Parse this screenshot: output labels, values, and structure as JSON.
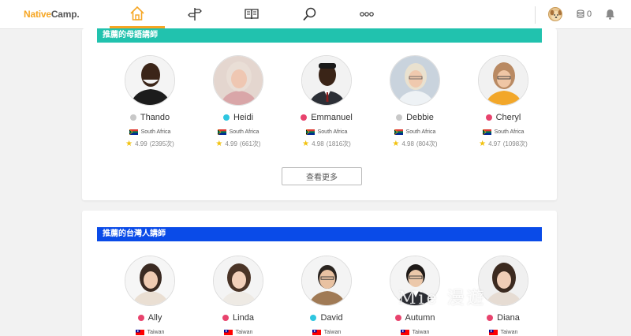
{
  "brand": {
    "part1": "Native",
    "part2": "Camp."
  },
  "nav": {
    "items": [
      {
        "icon": "home-icon",
        "active": true
      },
      {
        "icon": "signpost-icon",
        "active": false
      },
      {
        "icon": "book-icon",
        "active": false
      },
      {
        "icon": "search-icon",
        "active": false
      },
      {
        "icon": "more-icon",
        "active": false
      }
    ],
    "coins": "0"
  },
  "section1": {
    "title": "推薦的母語講師",
    "color": "#21c2ae",
    "more_label": "查看更多",
    "teachers": [
      {
        "name": "Thando",
        "status": "#c8c8c8",
        "country": "South Africa",
        "rating": "4.99",
        "reviews": "(2395次)"
      },
      {
        "name": "Heidi",
        "status": "#2ec6e0",
        "country": "South Africa",
        "rating": "4.99",
        "reviews": "(661次)"
      },
      {
        "name": "Emmanuel",
        "status": "#e8436d",
        "country": "South Africa",
        "rating": "4.98",
        "reviews": "(1816次)"
      },
      {
        "name": "Debbie",
        "status": "#c8c8c8",
        "country": "South Africa",
        "rating": "4.98",
        "reviews": "(804次)"
      },
      {
        "name": "Cheryl",
        "status": "#e8436d",
        "country": "South Africa",
        "rating": "4.97",
        "reviews": "(1098次)"
      }
    ]
  },
  "section2": {
    "title": "推薦的台灣人講師",
    "color": "#0a4be8",
    "teachers": [
      {
        "name": "Ally",
        "status": "#e8436d",
        "country": "Taiwan"
      },
      {
        "name": "Linda",
        "status": "#e8436d",
        "country": "Taiwan"
      },
      {
        "name": "David",
        "status": "#2ec6e0",
        "country": "Taiwan"
      },
      {
        "name": "Autumn",
        "status": "#e8436d",
        "country": "Taiwan"
      },
      {
        "name": "Diana",
        "status": "#e8436d",
        "country": "Taiwan"
      }
    ]
  },
  "watermark": "Mie 漫遊"
}
